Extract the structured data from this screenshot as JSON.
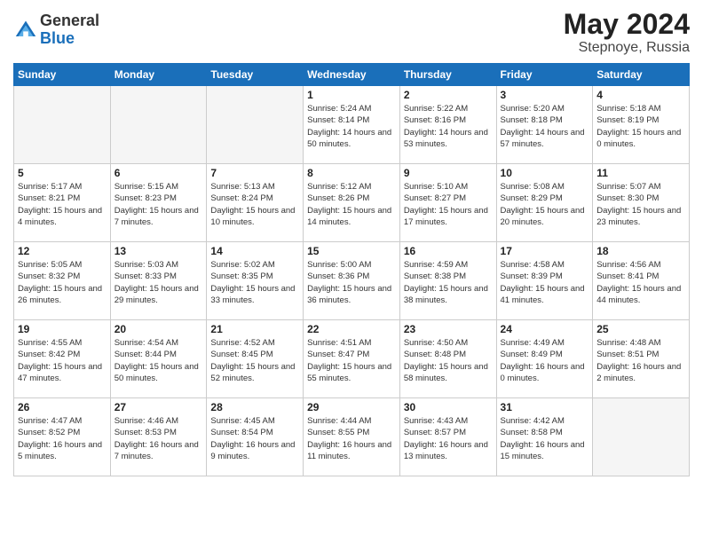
{
  "header": {
    "logo_general": "General",
    "logo_blue": "Blue",
    "month_year": "May 2024",
    "location": "Stepnoye, Russia"
  },
  "weekdays": [
    "Sunday",
    "Monday",
    "Tuesday",
    "Wednesday",
    "Thursday",
    "Friday",
    "Saturday"
  ],
  "weeks": [
    [
      {
        "day": "",
        "empty": true
      },
      {
        "day": "",
        "empty": true
      },
      {
        "day": "",
        "empty": true
      },
      {
        "day": "1",
        "sunrise": "5:24 AM",
        "sunset": "8:14 PM",
        "daylight": "14 hours and 50 minutes."
      },
      {
        "day": "2",
        "sunrise": "5:22 AM",
        "sunset": "8:16 PM",
        "daylight": "14 hours and 53 minutes."
      },
      {
        "day": "3",
        "sunrise": "5:20 AM",
        "sunset": "8:18 PM",
        "daylight": "14 hours and 57 minutes."
      },
      {
        "day": "4",
        "sunrise": "5:18 AM",
        "sunset": "8:19 PM",
        "daylight": "15 hours and 0 minutes."
      }
    ],
    [
      {
        "day": "5",
        "sunrise": "5:17 AM",
        "sunset": "8:21 PM",
        "daylight": "15 hours and 4 minutes."
      },
      {
        "day": "6",
        "sunrise": "5:15 AM",
        "sunset": "8:23 PM",
        "daylight": "15 hours and 7 minutes."
      },
      {
        "day": "7",
        "sunrise": "5:13 AM",
        "sunset": "8:24 PM",
        "daylight": "15 hours and 10 minutes."
      },
      {
        "day": "8",
        "sunrise": "5:12 AM",
        "sunset": "8:26 PM",
        "daylight": "15 hours and 14 minutes."
      },
      {
        "day": "9",
        "sunrise": "5:10 AM",
        "sunset": "8:27 PM",
        "daylight": "15 hours and 17 minutes."
      },
      {
        "day": "10",
        "sunrise": "5:08 AM",
        "sunset": "8:29 PM",
        "daylight": "15 hours and 20 minutes."
      },
      {
        "day": "11",
        "sunrise": "5:07 AM",
        "sunset": "8:30 PM",
        "daylight": "15 hours and 23 minutes."
      }
    ],
    [
      {
        "day": "12",
        "sunrise": "5:05 AM",
        "sunset": "8:32 PM",
        "daylight": "15 hours and 26 minutes."
      },
      {
        "day": "13",
        "sunrise": "5:03 AM",
        "sunset": "8:33 PM",
        "daylight": "15 hours and 29 minutes."
      },
      {
        "day": "14",
        "sunrise": "5:02 AM",
        "sunset": "8:35 PM",
        "daylight": "15 hours and 33 minutes."
      },
      {
        "day": "15",
        "sunrise": "5:00 AM",
        "sunset": "8:36 PM",
        "daylight": "15 hours and 36 minutes."
      },
      {
        "day": "16",
        "sunrise": "4:59 AM",
        "sunset": "8:38 PM",
        "daylight": "15 hours and 38 minutes."
      },
      {
        "day": "17",
        "sunrise": "4:58 AM",
        "sunset": "8:39 PM",
        "daylight": "15 hours and 41 minutes."
      },
      {
        "day": "18",
        "sunrise": "4:56 AM",
        "sunset": "8:41 PM",
        "daylight": "15 hours and 44 minutes."
      }
    ],
    [
      {
        "day": "19",
        "sunrise": "4:55 AM",
        "sunset": "8:42 PM",
        "daylight": "15 hours and 47 minutes."
      },
      {
        "day": "20",
        "sunrise": "4:54 AM",
        "sunset": "8:44 PM",
        "daylight": "15 hours and 50 minutes."
      },
      {
        "day": "21",
        "sunrise": "4:52 AM",
        "sunset": "8:45 PM",
        "daylight": "15 hours and 52 minutes."
      },
      {
        "day": "22",
        "sunrise": "4:51 AM",
        "sunset": "8:47 PM",
        "daylight": "15 hours and 55 minutes."
      },
      {
        "day": "23",
        "sunrise": "4:50 AM",
        "sunset": "8:48 PM",
        "daylight": "15 hours and 58 minutes."
      },
      {
        "day": "24",
        "sunrise": "4:49 AM",
        "sunset": "8:49 PM",
        "daylight": "16 hours and 0 minutes."
      },
      {
        "day": "25",
        "sunrise": "4:48 AM",
        "sunset": "8:51 PM",
        "daylight": "16 hours and 2 minutes."
      }
    ],
    [
      {
        "day": "26",
        "sunrise": "4:47 AM",
        "sunset": "8:52 PM",
        "daylight": "16 hours and 5 minutes."
      },
      {
        "day": "27",
        "sunrise": "4:46 AM",
        "sunset": "8:53 PM",
        "daylight": "16 hours and 7 minutes."
      },
      {
        "day": "28",
        "sunrise": "4:45 AM",
        "sunset": "8:54 PM",
        "daylight": "16 hours and 9 minutes."
      },
      {
        "day": "29",
        "sunrise": "4:44 AM",
        "sunset": "8:55 PM",
        "daylight": "16 hours and 11 minutes."
      },
      {
        "day": "30",
        "sunrise": "4:43 AM",
        "sunset": "8:57 PM",
        "daylight": "16 hours and 13 minutes."
      },
      {
        "day": "31",
        "sunrise": "4:42 AM",
        "sunset": "8:58 PM",
        "daylight": "16 hours and 15 minutes."
      },
      {
        "day": "",
        "empty": true
      }
    ]
  ]
}
